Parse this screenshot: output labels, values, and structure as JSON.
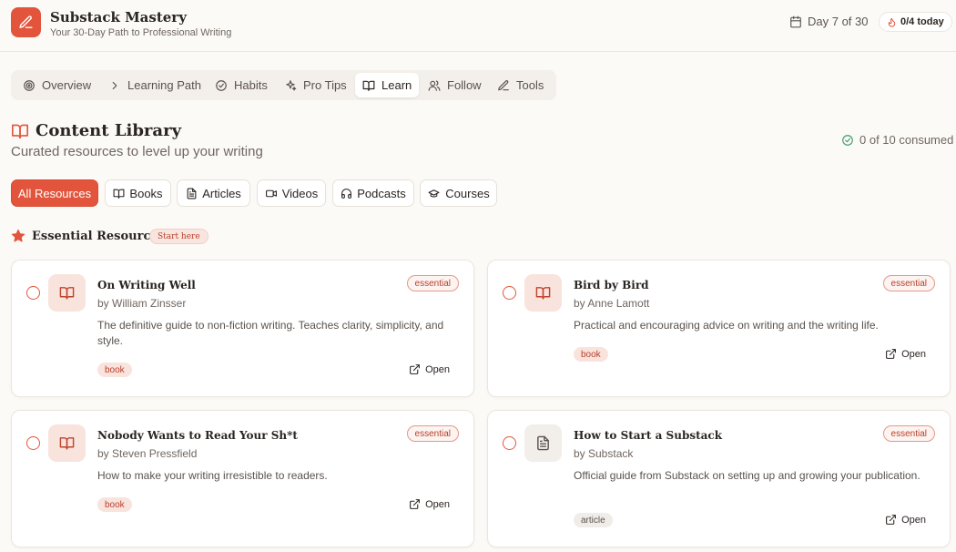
{
  "app": {
    "title": "Substack Mastery",
    "subtitle": "Your 30-Day Path to Professional Writing",
    "day_label": "Day 7 of 30",
    "today_label": "0/4 today",
    "brand_color": "#e2553c"
  },
  "nav": {
    "items": [
      {
        "label": "Overview",
        "icon": "target-icon"
      },
      {
        "label": "Learning Path",
        "icon": "chevron-right-icon"
      },
      {
        "label": "Habits",
        "icon": "check-circle-icon"
      },
      {
        "label": "Pro Tips",
        "icon": "sparkles-icon"
      },
      {
        "label": "Learn",
        "icon": "book-open-icon",
        "active": true
      },
      {
        "label": "Follow",
        "icon": "users-icon"
      },
      {
        "label": "Tools",
        "icon": "pencil-icon"
      }
    ]
  },
  "library": {
    "title": "Content Library",
    "subtitle": "Curated resources to level up your writing",
    "consumed_label": "0 of 10 consumed"
  },
  "filters": [
    {
      "label": "All Resources",
      "active": true
    },
    {
      "label": "Books",
      "icon": "book-open-icon"
    },
    {
      "label": "Articles",
      "icon": "file-text-icon"
    },
    {
      "label": "Videos",
      "icon": "video-icon"
    },
    {
      "label": "Podcasts",
      "icon": "headphones-icon"
    },
    {
      "label": "Courses",
      "icon": "graduation-cap-icon"
    }
  ],
  "essential": {
    "title": "Essential Resources",
    "badge": "Start here"
  },
  "resources": [
    {
      "title": "On Writing Well",
      "author": "by William Zinsser",
      "description": "The definitive guide to non-fiction writing. Teaches clarity, simplicity, and style.",
      "badge": "essential",
      "type": "book",
      "icon": "book-open-icon",
      "open_label": "Open"
    },
    {
      "title": "Bird by Bird",
      "author": "by Anne Lamott",
      "description": "Practical and encouraging advice on writing and the writing life.",
      "badge": "essential",
      "type": "book",
      "icon": "book-open-icon",
      "open_label": "Open"
    },
    {
      "title": "Nobody Wants to Read Your Sh*t",
      "author": "by Steven Pressfield",
      "description": "How to make your writing irresistible to readers.",
      "badge": "essential",
      "type": "book",
      "icon": "book-open-icon",
      "open_label": "Open"
    },
    {
      "title": "How to Start a Substack",
      "author": "by Substack",
      "description": "Official guide from Substack on setting up and growing your publication.",
      "badge": "essential",
      "type": "article",
      "icon": "file-text-icon",
      "open_label": "Open"
    }
  ]
}
